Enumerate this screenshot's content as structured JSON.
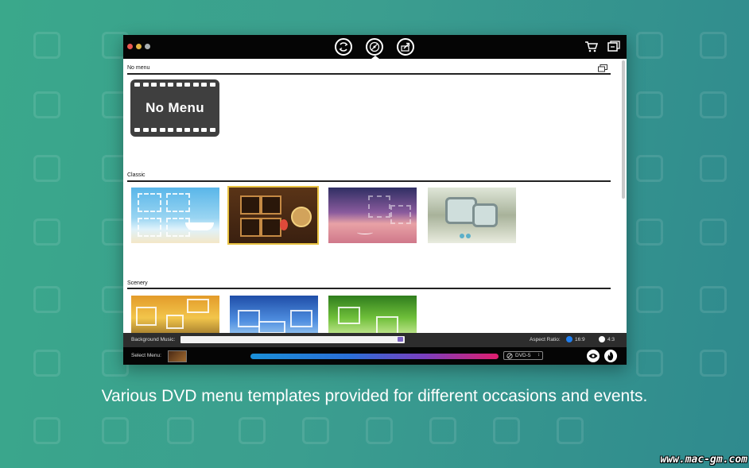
{
  "toolbar": {
    "icons": [
      "convert-icon",
      "disc-icon",
      "share-icon",
      "cart-icon",
      "register-icon"
    ]
  },
  "sections": [
    {
      "label": "No menu"
    },
    {
      "label": "Classic"
    },
    {
      "label": "Scenery"
    }
  ],
  "no_menu_text": "No Menu",
  "bottom": {
    "background_music_label": "Background Music:",
    "aspect_ratio_label": "Aspect Ratio:",
    "ratio_16_9": "16:9",
    "ratio_4_3": "4:3",
    "select_menu_label": "Select Menu:",
    "disc_type": "DVD-5"
  },
  "caption": "Various DVD menu templates provided for different occasions and events.",
  "watermark": "www.mac-gm.com",
  "colors": {
    "accent": "#1f7ff0",
    "selection": "#e8c241"
  }
}
